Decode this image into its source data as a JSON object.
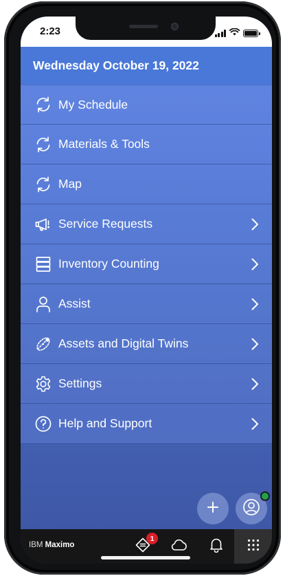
{
  "status_bar": {
    "time": "2:23"
  },
  "header": {
    "date": "Wednesday October 19, 2022"
  },
  "menu": {
    "items": [
      {
        "label": "My Schedule",
        "icon": "sync-icon",
        "has_chevron": false
      },
      {
        "label": "Materials & Tools",
        "icon": "sync-icon",
        "has_chevron": false
      },
      {
        "label": "Map",
        "icon": "sync-icon",
        "has_chevron": false
      },
      {
        "label": "Service Requests",
        "icon": "megaphone-icon",
        "has_chevron": true
      },
      {
        "label": "Inventory Counting",
        "icon": "storage-icon",
        "has_chevron": true
      },
      {
        "label": "Assist",
        "icon": "user-icon",
        "has_chevron": true
      },
      {
        "label": "Assets and Digital Twins",
        "icon": "asset-icon",
        "has_chevron": true
      },
      {
        "label": "Settings",
        "icon": "gear-icon",
        "has_chevron": true
      },
      {
        "label": "Help and Support",
        "icon": "help-icon",
        "has_chevron": true
      }
    ]
  },
  "floating": {
    "add_icon": "plus-icon",
    "profile_icon": "user-avatar-icon",
    "online_color": "#24a148"
  },
  "bottom_bar": {
    "brand_prefix": "IBM ",
    "brand_name": "Maximo",
    "work_badge": "1",
    "icons": [
      "work-order-icon",
      "cloud-icon",
      "bell-icon",
      "app-grid-icon"
    ]
  },
  "colors": {
    "header_bg": "#4a78d8",
    "menu_gradient_top": "#5f86e6",
    "menu_gradient_bottom": "#3d56a3",
    "bottom_bar_bg": "#161616",
    "badge_red": "#da1e28"
  }
}
